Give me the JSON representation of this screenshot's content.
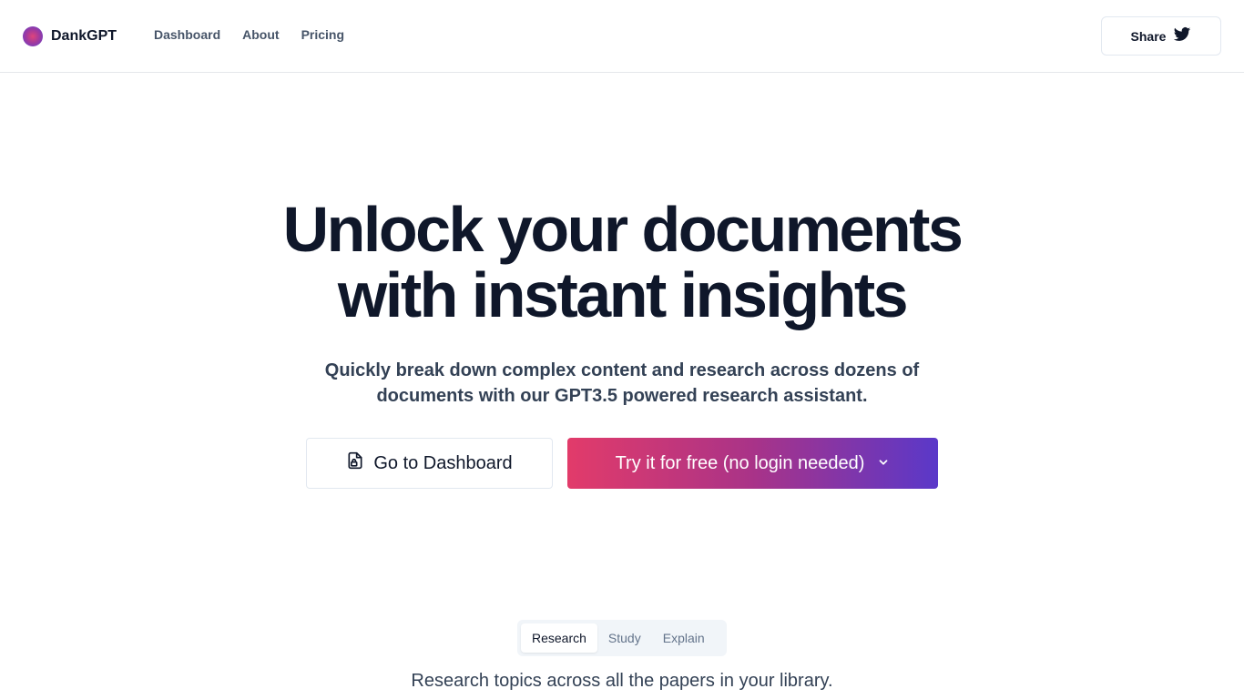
{
  "brand": {
    "name": "DankGPT",
    "logo_icon": "gradient-circle-logo"
  },
  "nav": {
    "items": [
      "Dashboard",
      "About",
      "Pricing"
    ]
  },
  "share": {
    "label": "Share",
    "icon": "twitter-bird-icon"
  },
  "hero": {
    "title_line1": "Unlock your documents",
    "title_line2": "with instant insights",
    "subtitle": "Quickly break down complex content and research across dozens of documents with our GPT3.5 powered research assistant."
  },
  "cta": {
    "dashboard_label": "Go to Dashboard",
    "dashboard_icon": "file-lock-icon",
    "try_label": "Try it for free (no login needed)",
    "try_icon": "chevron-down-icon"
  },
  "tabs": {
    "items": [
      "Research",
      "Study",
      "Explain"
    ],
    "active": "Research",
    "description": "Research topics across all the papers in your library."
  },
  "colors": {
    "gradient_start": "#e23b6a",
    "gradient_end": "#5a38c9",
    "text_dark": "#0f172a"
  }
}
